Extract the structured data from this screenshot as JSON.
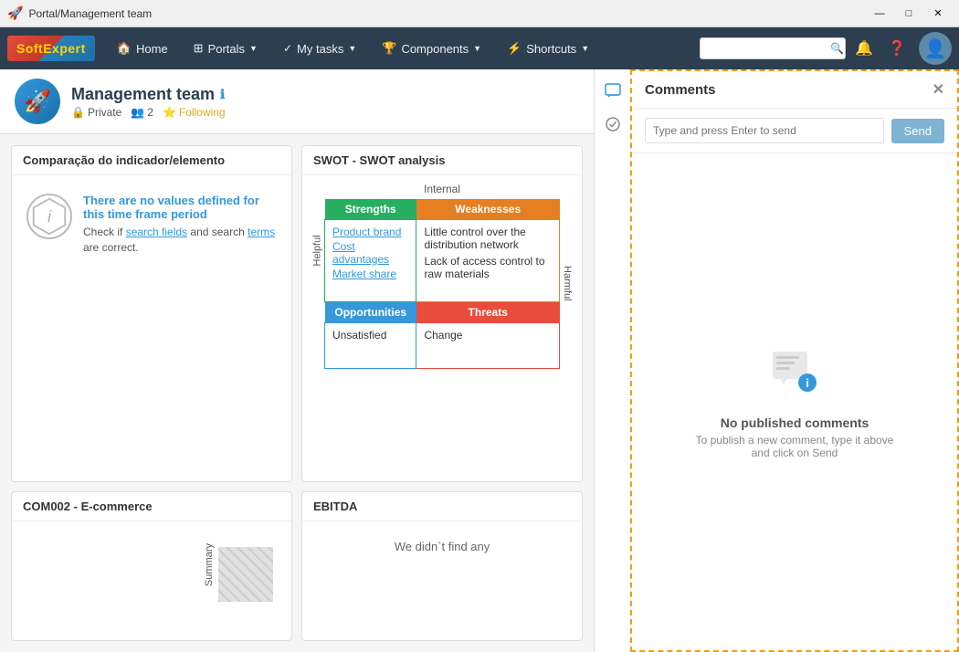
{
  "titleBar": {
    "title": "Portal/Management team",
    "iconGlyph": "🚀",
    "minimizeLabel": "—",
    "maximizeLabel": "□",
    "closeLabel": "✕"
  },
  "navbar": {
    "logo": {
      "text": "Soft",
      "highlight": "Expert"
    },
    "items": [
      {
        "id": "home",
        "icon": "🏠",
        "label": "Home",
        "hasCaret": false
      },
      {
        "id": "portals",
        "icon": "⊞",
        "label": "Portals",
        "hasCaret": true
      },
      {
        "id": "mytasks",
        "icon": "✓",
        "label": "My tasks",
        "hasCaret": true
      },
      {
        "id": "components",
        "icon": "🏆",
        "label": "Components",
        "hasCaret": true
      },
      {
        "id": "shortcuts",
        "icon": "⚡",
        "label": "Shortcuts",
        "hasCaret": true
      }
    ],
    "searchPlaceholder": "",
    "searchIcon": "🔍"
  },
  "pageHeader": {
    "title": "Management team",
    "metaPrivate": "Private",
    "metaUsers": "2",
    "metaFollowing": "Following"
  },
  "widgets": {
    "comparacao": {
      "title": "Comparação do indicador/elemento",
      "noValues": "There are no values defined for this time frame period",
      "hint": "Check if search fields and search terms are correct."
    },
    "swot": {
      "title": "SWOT - SWOT analysis",
      "internalLabel": "Internal",
      "helpfulLabel": "Helpful",
      "harmfulLabel": "Harmful",
      "headers": {
        "strengths": "Strengths",
        "weaknesses": "Weaknesses",
        "opportunities": "Opportunities",
        "threats": "Threats"
      },
      "strengthsItems": [
        "Product brand",
        "Cost advantages",
        "Market share"
      ],
      "weaknessesItems": [
        "Little control over the distribution network",
        "Lack of access control to raw materials"
      ],
      "opportunitiesItems": [
        "Unsatisfied"
      ],
      "threatsItems": [
        "Change"
      ]
    },
    "ecommerce": {
      "title": "COM002 - E-commerce",
      "summaryLabel": "Summary"
    },
    "ebitda": {
      "title": "EBITDA",
      "noDataText": "We didn`t find any"
    }
  },
  "comments": {
    "title": "Comments",
    "inputPlaceholder": "Type and press Enter to send",
    "sendLabel": "Send",
    "emptyTitle": "No published comments",
    "emptySubtitle": "To publish a new comment, type it above and click on Send",
    "closeLabel": "✕"
  }
}
